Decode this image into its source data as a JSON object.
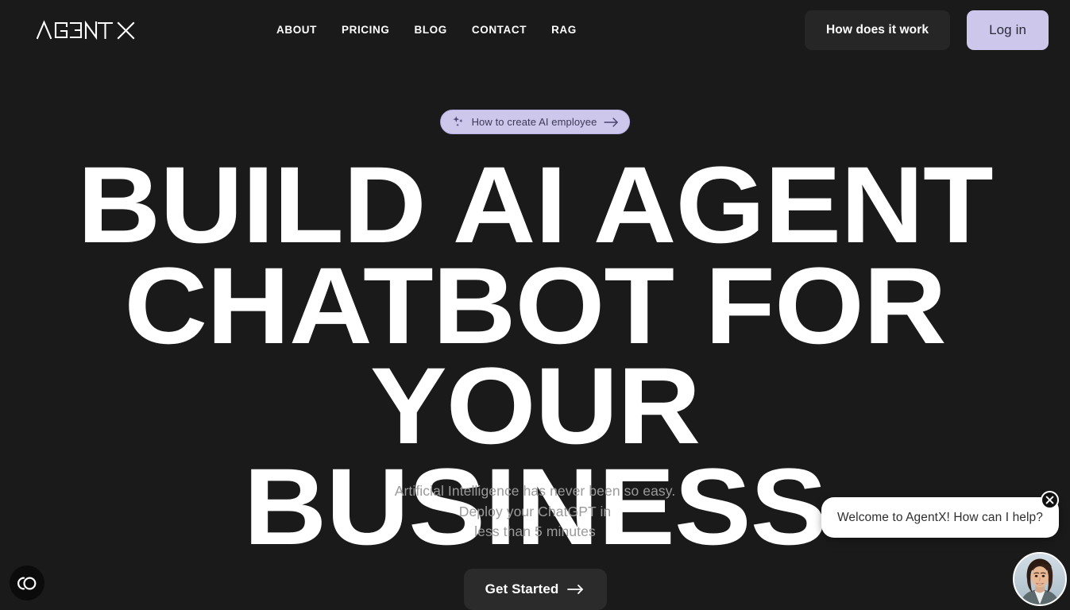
{
  "colors": {
    "page_bg": "#1a1a1a",
    "accent_lavender": "#cdc7ec",
    "button_dark": "#262626",
    "text_primary": "#ffffff",
    "text_muted": "#9a9a9a",
    "bubble_bg": "#ffffff"
  },
  "header": {
    "logo_text": "AGENTX",
    "nav": [
      {
        "label": "ABOUT"
      },
      {
        "label": "PRICING"
      },
      {
        "label": "BLOG"
      },
      {
        "label": "CONTACT"
      },
      {
        "label": "RAG"
      }
    ],
    "how_it_works_label": "How does it work",
    "login_label": "Log in"
  },
  "hero": {
    "pill": {
      "label": "How to create AI employee",
      "leading_icon": "sparkles-icon",
      "trailing_icon": "arrow-right-icon"
    },
    "headline_lines": [
      "BUILD AI AGENT",
      "CHATBOT FOR YOUR",
      "BUSINESS"
    ],
    "subtitle_lines": [
      "Artificial Intelligence has never been so easy.",
      "Deploy your ChatGPT in",
      "less than 5 minutes"
    ],
    "cta_label": "Get Started",
    "cta_icon": "arrow-right-icon"
  },
  "accessibility_widget": {
    "icon": "accessibility-toggle-icon",
    "label": ""
  },
  "chat_widget": {
    "message": "Welcome to AgentX! How can I help?",
    "close_icon": "close-icon",
    "avatar": "agent-avatar"
  }
}
